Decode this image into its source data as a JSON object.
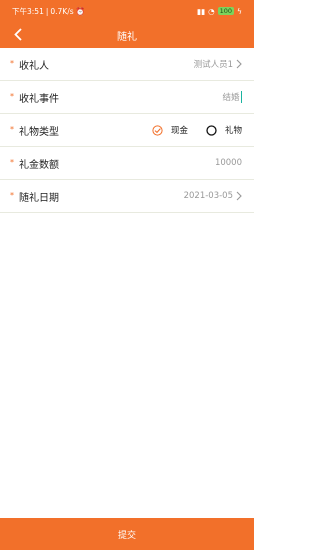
{
  "status_bar": {
    "time": "下午3:51",
    "speed": "0.7K/s",
    "battery": "100"
  },
  "header": {
    "title": "随礼"
  },
  "form": {
    "recipient": {
      "label": "收礼人",
      "value": "测试人员1"
    },
    "event": {
      "label": "收礼事件",
      "value": "结婚"
    },
    "gift_type": {
      "label": "礼物类型",
      "options": [
        "现金",
        "礼物"
      ],
      "selected": "现金"
    },
    "amount": {
      "label": "礼金数额",
      "value": "10000"
    },
    "date": {
      "label": "随礼日期",
      "value": "2021-03-05"
    }
  },
  "submit_label": "提交",
  "colors": {
    "accent": "#f2702a",
    "divider": "#e8eadf",
    "cursor": "#1bb3a0"
  }
}
